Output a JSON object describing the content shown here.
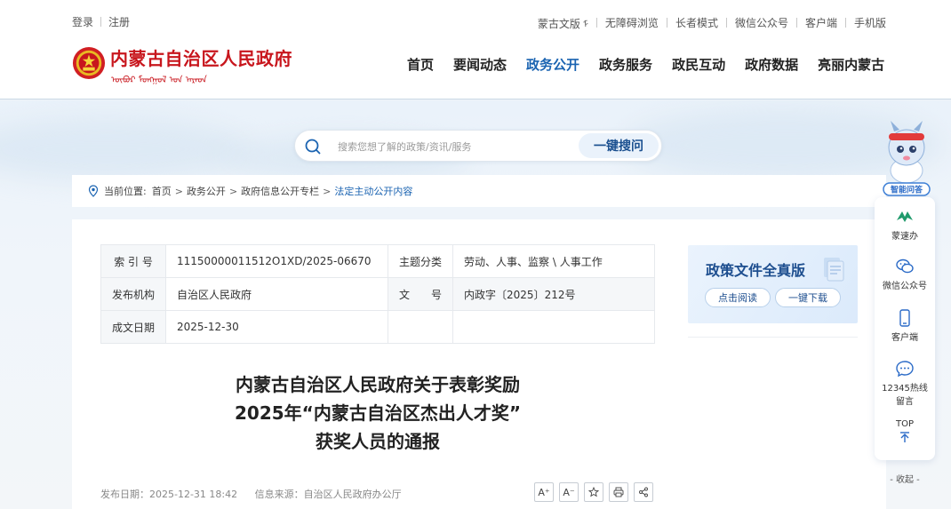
{
  "header": {
    "left_links": [
      "登录",
      "注册"
    ],
    "right_links": [
      "蒙古文版",
      "无障碍浏览",
      "长者模式",
      "微信公众号",
      "客户端",
      "手机版"
    ],
    "right_link_glyph": "ᠮ",
    "site_title": "内蒙古自治区人民政府",
    "site_title_mongolian": "ᠥᠪᠥᠷ ᠮᠣᠩᠭᠣᠯ ᠤᠨ ᠠᠷᠠᠳ",
    "nav": [
      "首页",
      "要闻动态",
      "政务公开",
      "政务服务",
      "政民互动",
      "政府数据",
      "亮丽内蒙古"
    ],
    "active_nav": "政务公开"
  },
  "search": {
    "placeholder": "搜索您想了解的政策/资讯/服务",
    "button_label": "一键搜问"
  },
  "breadcrumb": {
    "prefix": "当前位置:",
    "items": [
      "首页",
      "政务公开",
      "政府信息公开专栏"
    ],
    "current": "法定主动公开内容",
    "separator": ">"
  },
  "meta": {
    "index_label": "索 引 号",
    "index_value": "11150000011512O1XD/2025-06670",
    "topic_label": "主题分类",
    "topic_value": "劳动、人事、监察 \\ 人事工作",
    "publisher_label": "发布机构",
    "publisher_value": "自治区人民政府",
    "docno_label": "文　　号",
    "docno_value": "内政字〔2025〕212号",
    "date_label": "成文日期",
    "date_value": "2025-12-30"
  },
  "promo": {
    "title": "政策文件全真版",
    "read_label": "点击阅读",
    "download_label": "一键下载"
  },
  "document": {
    "title_lines": [
      "内蒙古自治区人民政府关于表彰奖励",
      "2025年“内蒙古自治区杰出人才奖”",
      "获奖人员的通报"
    ],
    "publish_date": "发布日期：2025-12-31 18:42",
    "source": "信息来源：自治区人民政府办公厅",
    "tool_font_up": "A⁺",
    "tool_font_down": "A⁻"
  },
  "floatbar": {
    "mascot_badge": "智能问答",
    "items": [
      "蒙速办",
      "微信公众号",
      "客户端",
      "12345热线",
      "留言"
    ],
    "top_label": "TOP",
    "collapse_label": "- 收起 -"
  },
  "colors": {
    "brand_red": "#c8161d",
    "nav_active": "#1a63b1",
    "accent_blue": "#1d4e8f"
  }
}
